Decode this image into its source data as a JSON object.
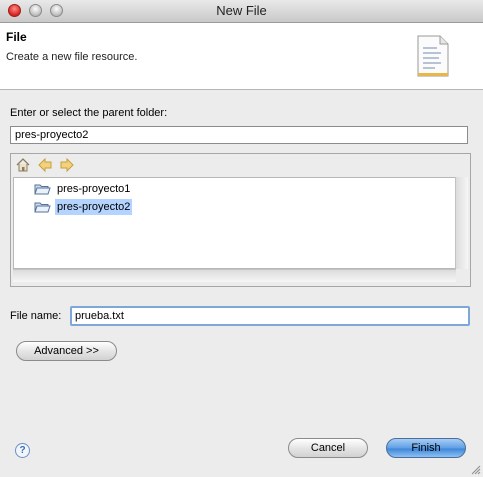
{
  "window": {
    "title": "New File"
  },
  "banner": {
    "title": "File",
    "description": "Create a new file resource."
  },
  "parent_folder": {
    "label": "Enter or select the parent folder:",
    "value": "pres-proyecto2"
  },
  "tree": {
    "items": [
      {
        "label": "pres-proyecto1",
        "selected": false
      },
      {
        "label": "pres-proyecto2",
        "selected": true
      }
    ]
  },
  "file_name": {
    "label": "File name:",
    "value": "prueba.txt"
  },
  "buttons": {
    "advanced": "Advanced >>",
    "cancel": "Cancel",
    "finish": "Finish",
    "help": "?"
  },
  "colors": {
    "selection": "#b5d3ff",
    "focus_ring": "#7ea7d9",
    "default_button": "#3f87d9"
  },
  "icons": {
    "home": "home-icon",
    "back": "back-arrow-icon",
    "forward": "forward-arrow-icon",
    "folder": "folder-open-icon",
    "document": "document-icon",
    "help": "help-icon"
  }
}
